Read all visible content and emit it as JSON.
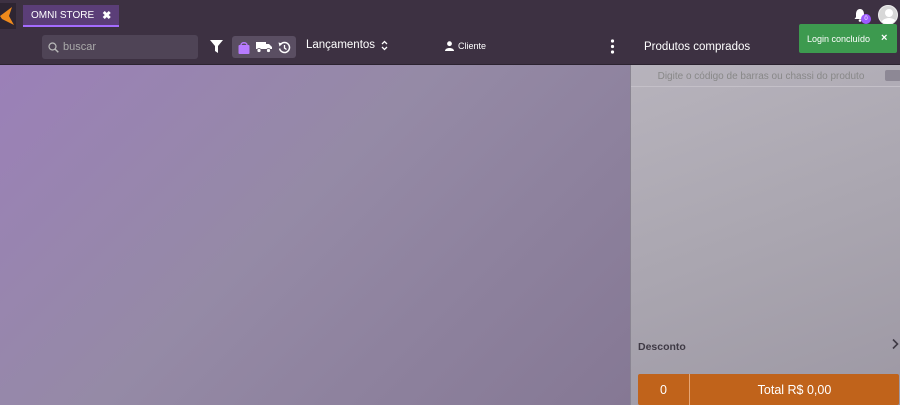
{
  "app": {
    "tab_label": "OMNI STORE",
    "tab_close": "✖"
  },
  "toolbar": {
    "search_placeholder": "buscar",
    "launch_label": "Lançamentos",
    "client_label": "Cliente",
    "products_title": "Produtos comprados"
  },
  "panel": {
    "barcode_placeholder": "Digite o código de barras ou chassi do produto",
    "discount_label": "Desconto",
    "total_count": "0",
    "total_label": "Total R$ 0,00"
  },
  "toast": {
    "message": "Login concluído",
    "close": "×"
  },
  "notifications": {
    "badge": "0"
  },
  "colors": {
    "accent": "#a46cff",
    "total_bar": "#c0631b",
    "toast": "#3d9a4f",
    "topbar": "#3d3142"
  }
}
